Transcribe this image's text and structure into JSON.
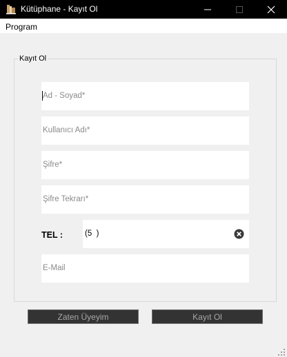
{
  "window": {
    "title": "Kütüphane - Kayıt Ol",
    "icon": "library-app-icon"
  },
  "menu": {
    "items": [
      "Program"
    ]
  },
  "form": {
    "group_title": "Kayıt Ol",
    "fields": {
      "fullname_placeholder": "Ad - Soyad*",
      "username_placeholder": "Kullanıcı Adı*",
      "password_placeholder": "Şifre*",
      "password_repeat_placeholder": "Şifre Tekrarı*",
      "email_placeholder": "E-Mail"
    },
    "phone": {
      "label": "TEL :",
      "value": "(5  )"
    },
    "buttons": {
      "login_label": "Zaten Üyeyim",
      "register_label": "Kayıt Ol"
    }
  },
  "colors": {
    "titlebar": "#000000",
    "button_bg": "#333333",
    "button_text": "#a8a8a8"
  }
}
